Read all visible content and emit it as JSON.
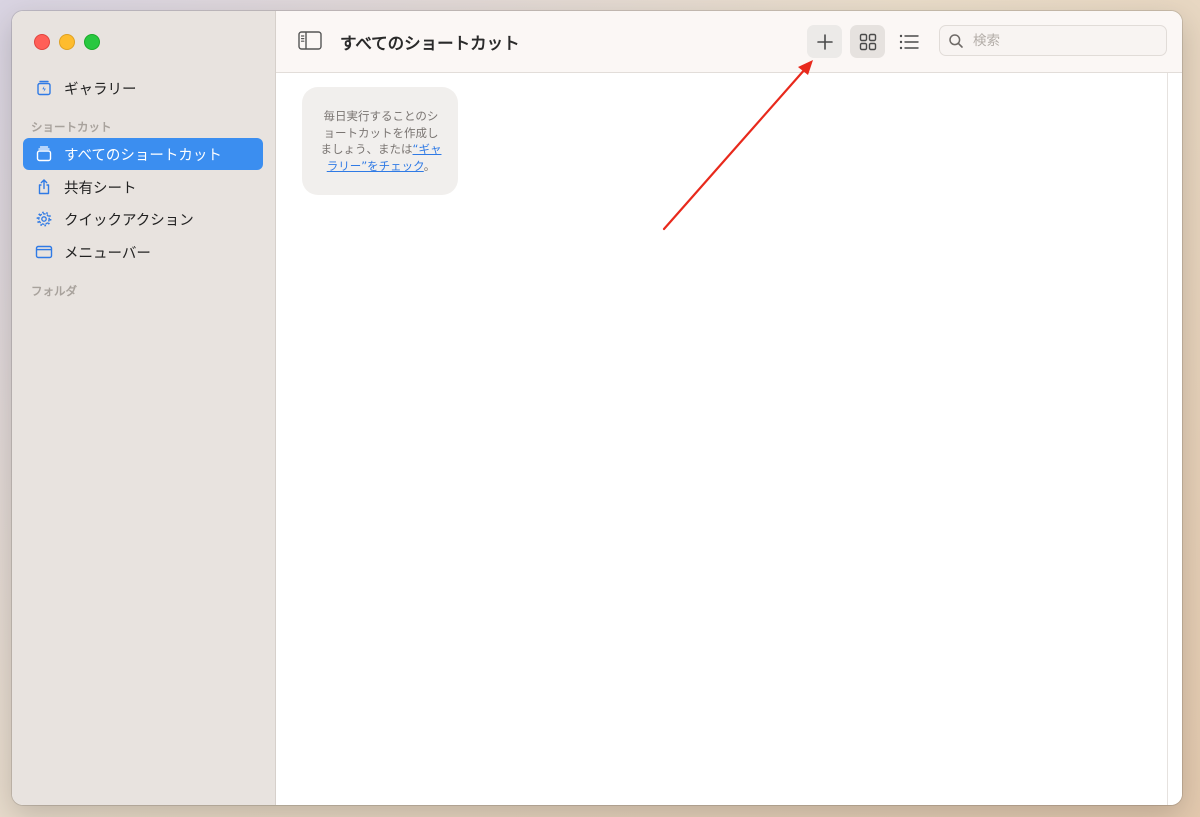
{
  "sidebar": {
    "gallery_label": "ギャラリー",
    "section_shortcuts": "ショートカット",
    "items": [
      {
        "label": "すべてのショートカット",
        "icon": "shortcuts-stack-icon"
      },
      {
        "label": "共有シート",
        "icon": "share-icon"
      },
      {
        "label": "クイックアクション",
        "icon": "gear-icon"
      },
      {
        "label": "メニューバー",
        "icon": "menubar-window-icon"
      }
    ],
    "section_folders": "フォルダ"
  },
  "toolbar": {
    "title": "すべてのショートカット",
    "search_placeholder": "検索"
  },
  "empty_state": {
    "text": "毎日実行することのショートカットを作成しましょう、または",
    "link": "“ギャラリー”をチェック",
    "suffix": "。"
  },
  "colors": {
    "accent": "#3b8ef0",
    "annotation_arrow": "#e8291c"
  }
}
